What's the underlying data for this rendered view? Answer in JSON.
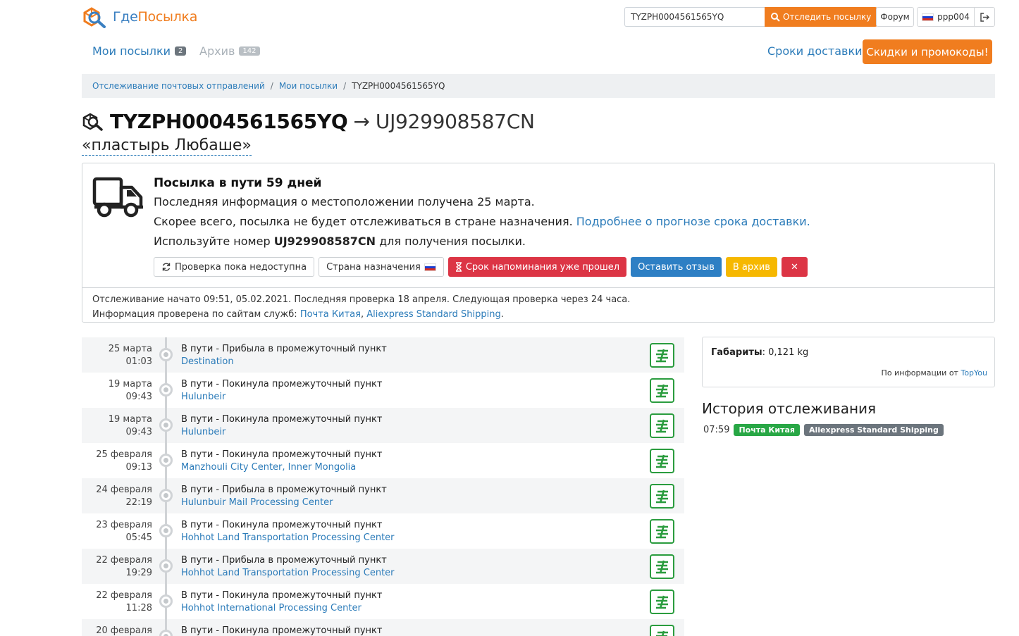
{
  "header": {
    "logo_part1": "Где",
    "logo_part2": "Посылка",
    "search_value": "TYZPH0004561565YQ",
    "track_button": "Отследить посылку",
    "forum_button": "Форум",
    "username": "ppp004"
  },
  "nav": {
    "my_parcels": "Мои посылки",
    "my_parcels_count": "2",
    "archive": "Архив",
    "archive_count": "142",
    "delivery_times": "Сроки доставки",
    "promo_button": "Скидки и промокоды!"
  },
  "breadcrumb": {
    "items": [
      "Отслеживание почтовых отправлений",
      "Мои посылки"
    ],
    "current": "TYZPH0004561565YQ",
    "separator": "/"
  },
  "parcel": {
    "tracking_number": "TYZPH0004561565YQ",
    "arrow": "→",
    "alt_number": "UJ929908587CN",
    "name": "«пластырь Любаше»"
  },
  "status": {
    "headline": "Посылка в пути 59 дней",
    "last_info": "Последняя информация о местоположении получена 25 марта.",
    "forecast": "Скорее всего, посылка не будет отслеживаться в стране назначения.",
    "forecast_link": "Подробнее о прогнозе срока доставки.",
    "use_prefix": "Используйте номер",
    "use_number": "UJ929908587CN",
    "use_suffix": "для получения посылки.",
    "buttons": {
      "check": "Проверка пока недоступна",
      "destination": "Страна назначения",
      "reminder": "Срок напоминания уже прошел",
      "review": "Оставить отзыв",
      "archive": "В архив",
      "close": "✕"
    },
    "footer_line1": "Отслеживание начато 09:51, 05.02.2021. Последняя проверка 18 апреля. Следующая проверка через 24 часа.",
    "footer_line2_prefix": "Информация проверена по сайтам служб:",
    "service1": "Почта Китая",
    "service_sep": ",",
    "service2": "Aliexpress Standard Shipping",
    "footer_end": "."
  },
  "timeline": [
    {
      "date": "25 марта",
      "time": "01:03",
      "status": "В пути - Прибыла в промежуточный пункт",
      "place": "Destination"
    },
    {
      "date": "19 марта",
      "time": "09:43",
      "status": "В пути - Покинула промежуточный пункт",
      "place": "Hulunbeir"
    },
    {
      "date": "19 марта",
      "time": "09:43",
      "status": "В пути - Покинула промежуточный пункт",
      "place": "Hulunbeir"
    },
    {
      "date": "25 февраля",
      "time": "09:13",
      "status": "В пути - Покинула промежуточный пункт",
      "place": "Manzhouli City Center, Inner Mongolia"
    },
    {
      "date": "24 февраля",
      "time": "22:19",
      "status": "В пути - Прибыла в промежуточный пункт",
      "place": "Hulunbuir Mail Processing Center"
    },
    {
      "date": "23 февраля",
      "time": "05:45",
      "status": "В пути - Покинула промежуточный пункт",
      "place": "Hohhot Land Transportation Processing Center"
    },
    {
      "date": "22 февраля",
      "time": "19:29",
      "status": "В пути - Прибыла в промежуточный пункт",
      "place": "Hohhot Land Transportation Processing Center"
    },
    {
      "date": "22 февраля",
      "time": "11:28",
      "status": "В пути - Покинула промежуточный пункт",
      "place": "Hohhot International Processing Center"
    },
    {
      "date": "20 февраля",
      "time": "",
      "status": "В пути - Покинула промежуточный пункт",
      "place": ""
    }
  ],
  "dimensions": {
    "label": "Габариты",
    "value": ": 0,121 kg",
    "source_prefix": "По информации от",
    "source": "TopYou"
  },
  "history": {
    "title": "История отслеживания",
    "time": "07:59",
    "tag1": "Почта Китая",
    "tag2": "Aliexpress Standard Shipping"
  },
  "colors": {
    "brand_orange": "#f07d1f",
    "link_blue": "#2b7bb9",
    "china_post_green": "#2a9c3e"
  }
}
